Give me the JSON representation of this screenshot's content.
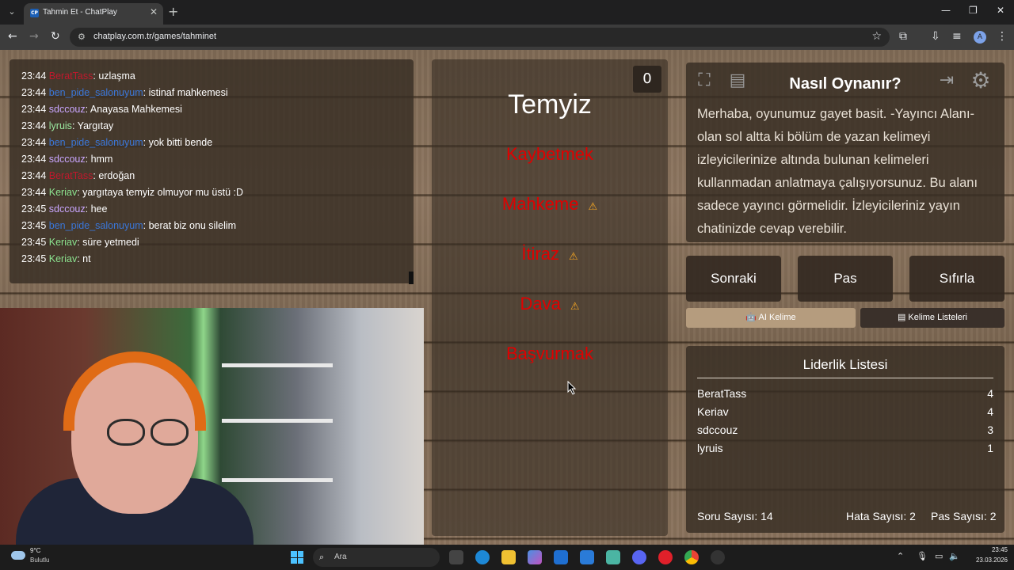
{
  "browser": {
    "tab_title": "Tahmin Et - ChatPlay",
    "favicon_text": "CP",
    "url": "chatplay.com.tr/games/tahminet",
    "profile_initial": "A"
  },
  "chat": {
    "messages": [
      {
        "time": "23:44",
        "user": "BeratTass",
        "user_color": "#c0182c",
        "text": "uzlaşma"
      },
      {
        "time": "23:44",
        "user": "ben_pide_salonuyum",
        "user_color": "#3a76d8",
        "text": "istinaf mahkemesi"
      },
      {
        "time": "23:44",
        "user": "sdccouz",
        "user_color": "#c9a6ff",
        "text": "Anayasa Mahkemesi"
      },
      {
        "time": "23:44",
        "user": "lyruis",
        "user_color": "#9be8a0",
        "text": "Yargıtay"
      },
      {
        "time": "23:44",
        "user": "ben_pide_salonuyum",
        "user_color": "#3a76d8",
        "text": "yok bitti bende"
      },
      {
        "time": "23:44",
        "user": "sdccouz",
        "user_color": "#c9a6ff",
        "text": "hmm"
      },
      {
        "time": "23:44",
        "user": "BeratTass",
        "user_color": "#c0182c",
        "text": "erdoğan"
      },
      {
        "time": "23:44",
        "user": "Keriav",
        "user_color": "#8be28f",
        "text": "yargıtaya temyiz olmuyor mu üstü :D"
      },
      {
        "time": "23:45",
        "user": "sdccouz",
        "user_color": "#c9a6ff",
        "text": "hee"
      },
      {
        "time": "23:45",
        "user": "ben_pide_salonuyum",
        "user_color": "#3a76d8",
        "text": "berat biz onu silelim"
      },
      {
        "time": "23:45",
        "user": "Keriav",
        "user_color": "#8be28f",
        "text": "süre yetmedi"
      },
      {
        "time": "23:45",
        "user": "Keriav",
        "user_color": "#8be28f",
        "text": "nt"
      }
    ]
  },
  "game": {
    "counter": "0",
    "main_word": "Temyiz",
    "taboo_words": [
      {
        "word": "Kaybetmek",
        "warning": false
      },
      {
        "word": "Mahkeme",
        "warning": true
      },
      {
        "word": "İtiraz",
        "warning": true
      },
      {
        "word": "Dava",
        "warning": true
      },
      {
        "word": "Başvurmak",
        "warning": false
      }
    ],
    "warning_glyph": "⚠"
  },
  "how_to": {
    "title": "Nasıl Oynanır?",
    "text": "Merhaba, oyunumuz gayet basit. -Yayıncı Alanı- olan sol altta ki bölüm de yazan kelimeyi izleyicilerinize altında bulunan kelimeleri kullanmadan anlatmaya çalışıyorsunuz. Bu alanı sadece yayıncı görmelidir. İzleyicileriniz yayın chatinizde cevap verebilir."
  },
  "buttons": {
    "next": "Sonraki",
    "pass": "Pas",
    "reset": "Sıfırla",
    "ai_word": "AI Kelime",
    "word_lists": "Kelime Listeleri"
  },
  "leaderboard": {
    "title": "Liderlik Listesi",
    "rows": [
      {
        "name": "BeratTass",
        "score": "4"
      },
      {
        "name": "Keriav",
        "score": "4"
      },
      {
        "name": "sdccouz",
        "score": "3"
      },
      {
        "name": "lyruis",
        "score": "1"
      }
    ],
    "question_count": "Soru Sayısı: 14",
    "error_count": "Hata Sayısı: 2",
    "pass_count": "Pas Sayısı: 2"
  },
  "taskbar": {
    "temperature": "9°C",
    "weather": "Bulutlu",
    "search_placeholder": "Ara",
    "time": "23:45",
    "date": "23.03.2026"
  }
}
